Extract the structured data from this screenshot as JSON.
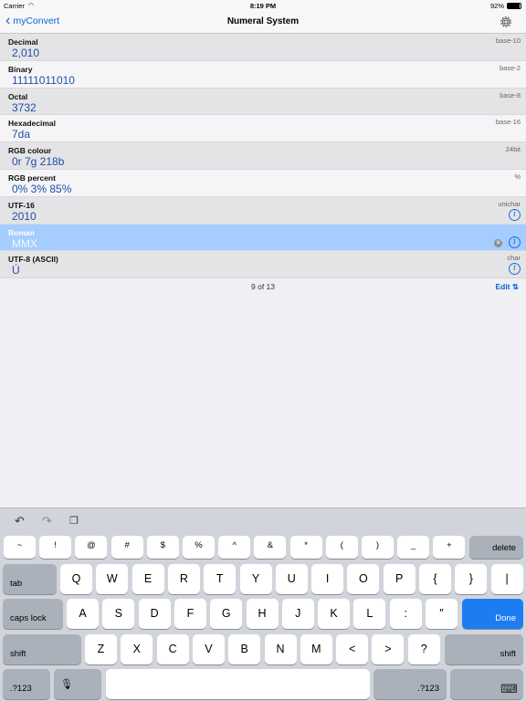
{
  "status": {
    "carrier": "Carrier",
    "time": "8:19 PM",
    "battery": "92%",
    "battery_level": 0.92
  },
  "nav": {
    "back_label": "myConvert",
    "title": "Numeral System"
  },
  "rows": [
    {
      "label": "Decimal",
      "value": "2,010",
      "unit": "base-10"
    },
    {
      "label": "Binary",
      "value": "11111011010",
      "unit": "base-2"
    },
    {
      "label": "Octal",
      "value": "3732",
      "unit": "base-8"
    },
    {
      "label": "Hexadecimal",
      "value": "7da",
      "unit": "base-16"
    },
    {
      "label": "RGB colour",
      "value": "0r 7g 218b",
      "unit": "24bit"
    },
    {
      "label": "RGB percent",
      "value": "0% 3% 85%",
      "unit": "%"
    },
    {
      "label": "UTF-16",
      "value": "2010",
      "unit": "unichar"
    },
    {
      "label": "Roman",
      "value": "MMX",
      "unit": ""
    },
    {
      "label": "UTF-8 (ASCII)",
      "value": "Ú",
      "unit": "char"
    }
  ],
  "footer": {
    "count": "9 of 13",
    "edit": "Edit ⇅"
  },
  "keyboard": {
    "row1": [
      "~",
      "!",
      "@",
      "#",
      "$",
      "%",
      "^",
      "&",
      "*",
      "(",
      ")",
      "_",
      "+"
    ],
    "delete": "delete",
    "tab": "tab",
    "row2": [
      "Q",
      "W",
      "E",
      "R",
      "T",
      "Y",
      "U",
      "I",
      "O",
      "P",
      "{",
      "}",
      "|"
    ],
    "caps": "caps lock",
    "row3": [
      "A",
      "S",
      "D",
      "F",
      "G",
      "H",
      "J",
      "K",
      "L",
      ":",
      "″"
    ],
    "done": "Done",
    "shift": "shift",
    "row4": [
      "Z",
      "X",
      "C",
      "V",
      "B",
      "N",
      "M",
      "<",
      ">",
      "?"
    ],
    "numsym": ".?123"
  }
}
